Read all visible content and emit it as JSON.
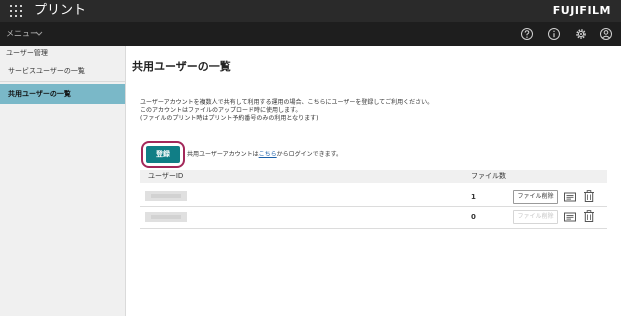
{
  "header": {
    "title": "プリント",
    "brand": "FUJIFILM"
  },
  "menubar": {
    "menu_label": "メニュー",
    "icons": [
      "help-icon",
      "info-icon",
      "gear-icon",
      "account-icon"
    ]
  },
  "sidebar": {
    "section_label": "ユーザー管理",
    "items": [
      {
        "label": "サービスユーザーの一覧",
        "active": false
      },
      {
        "label": "共用ユーザーの一覧",
        "active": true
      }
    ]
  },
  "main": {
    "title": "共用ユーザーの一覧",
    "description": [
      "ユーザーアカウントを複数人で共有して利用する運用の場合、こちらにユーザーを登録してご利用ください。",
      "このアカウントはファイルのアップロード時に使用します。",
      "(ファイルのプリント時はプリント予約番号のみの利用となります)"
    ],
    "register_button": "登録",
    "register_note_prefix": "共用ユーザーアカウントは",
    "register_note_link": "こちら",
    "register_note_suffix": "からログインできます。",
    "table": {
      "columns": [
        "ユーザーID",
        "ファイル数"
      ],
      "delete_label": "ファイル削除",
      "rows": [
        {
          "file_count": "1",
          "delete_enabled": true
        },
        {
          "file_count": "0",
          "delete_enabled": false
        }
      ]
    }
  },
  "colors": {
    "header_bg": "#2a2a2a",
    "active_nav": "#7ab8c8",
    "primary_button": "#107e86",
    "highlight_ring": "#a3285a",
    "link": "#1a5fa8"
  }
}
